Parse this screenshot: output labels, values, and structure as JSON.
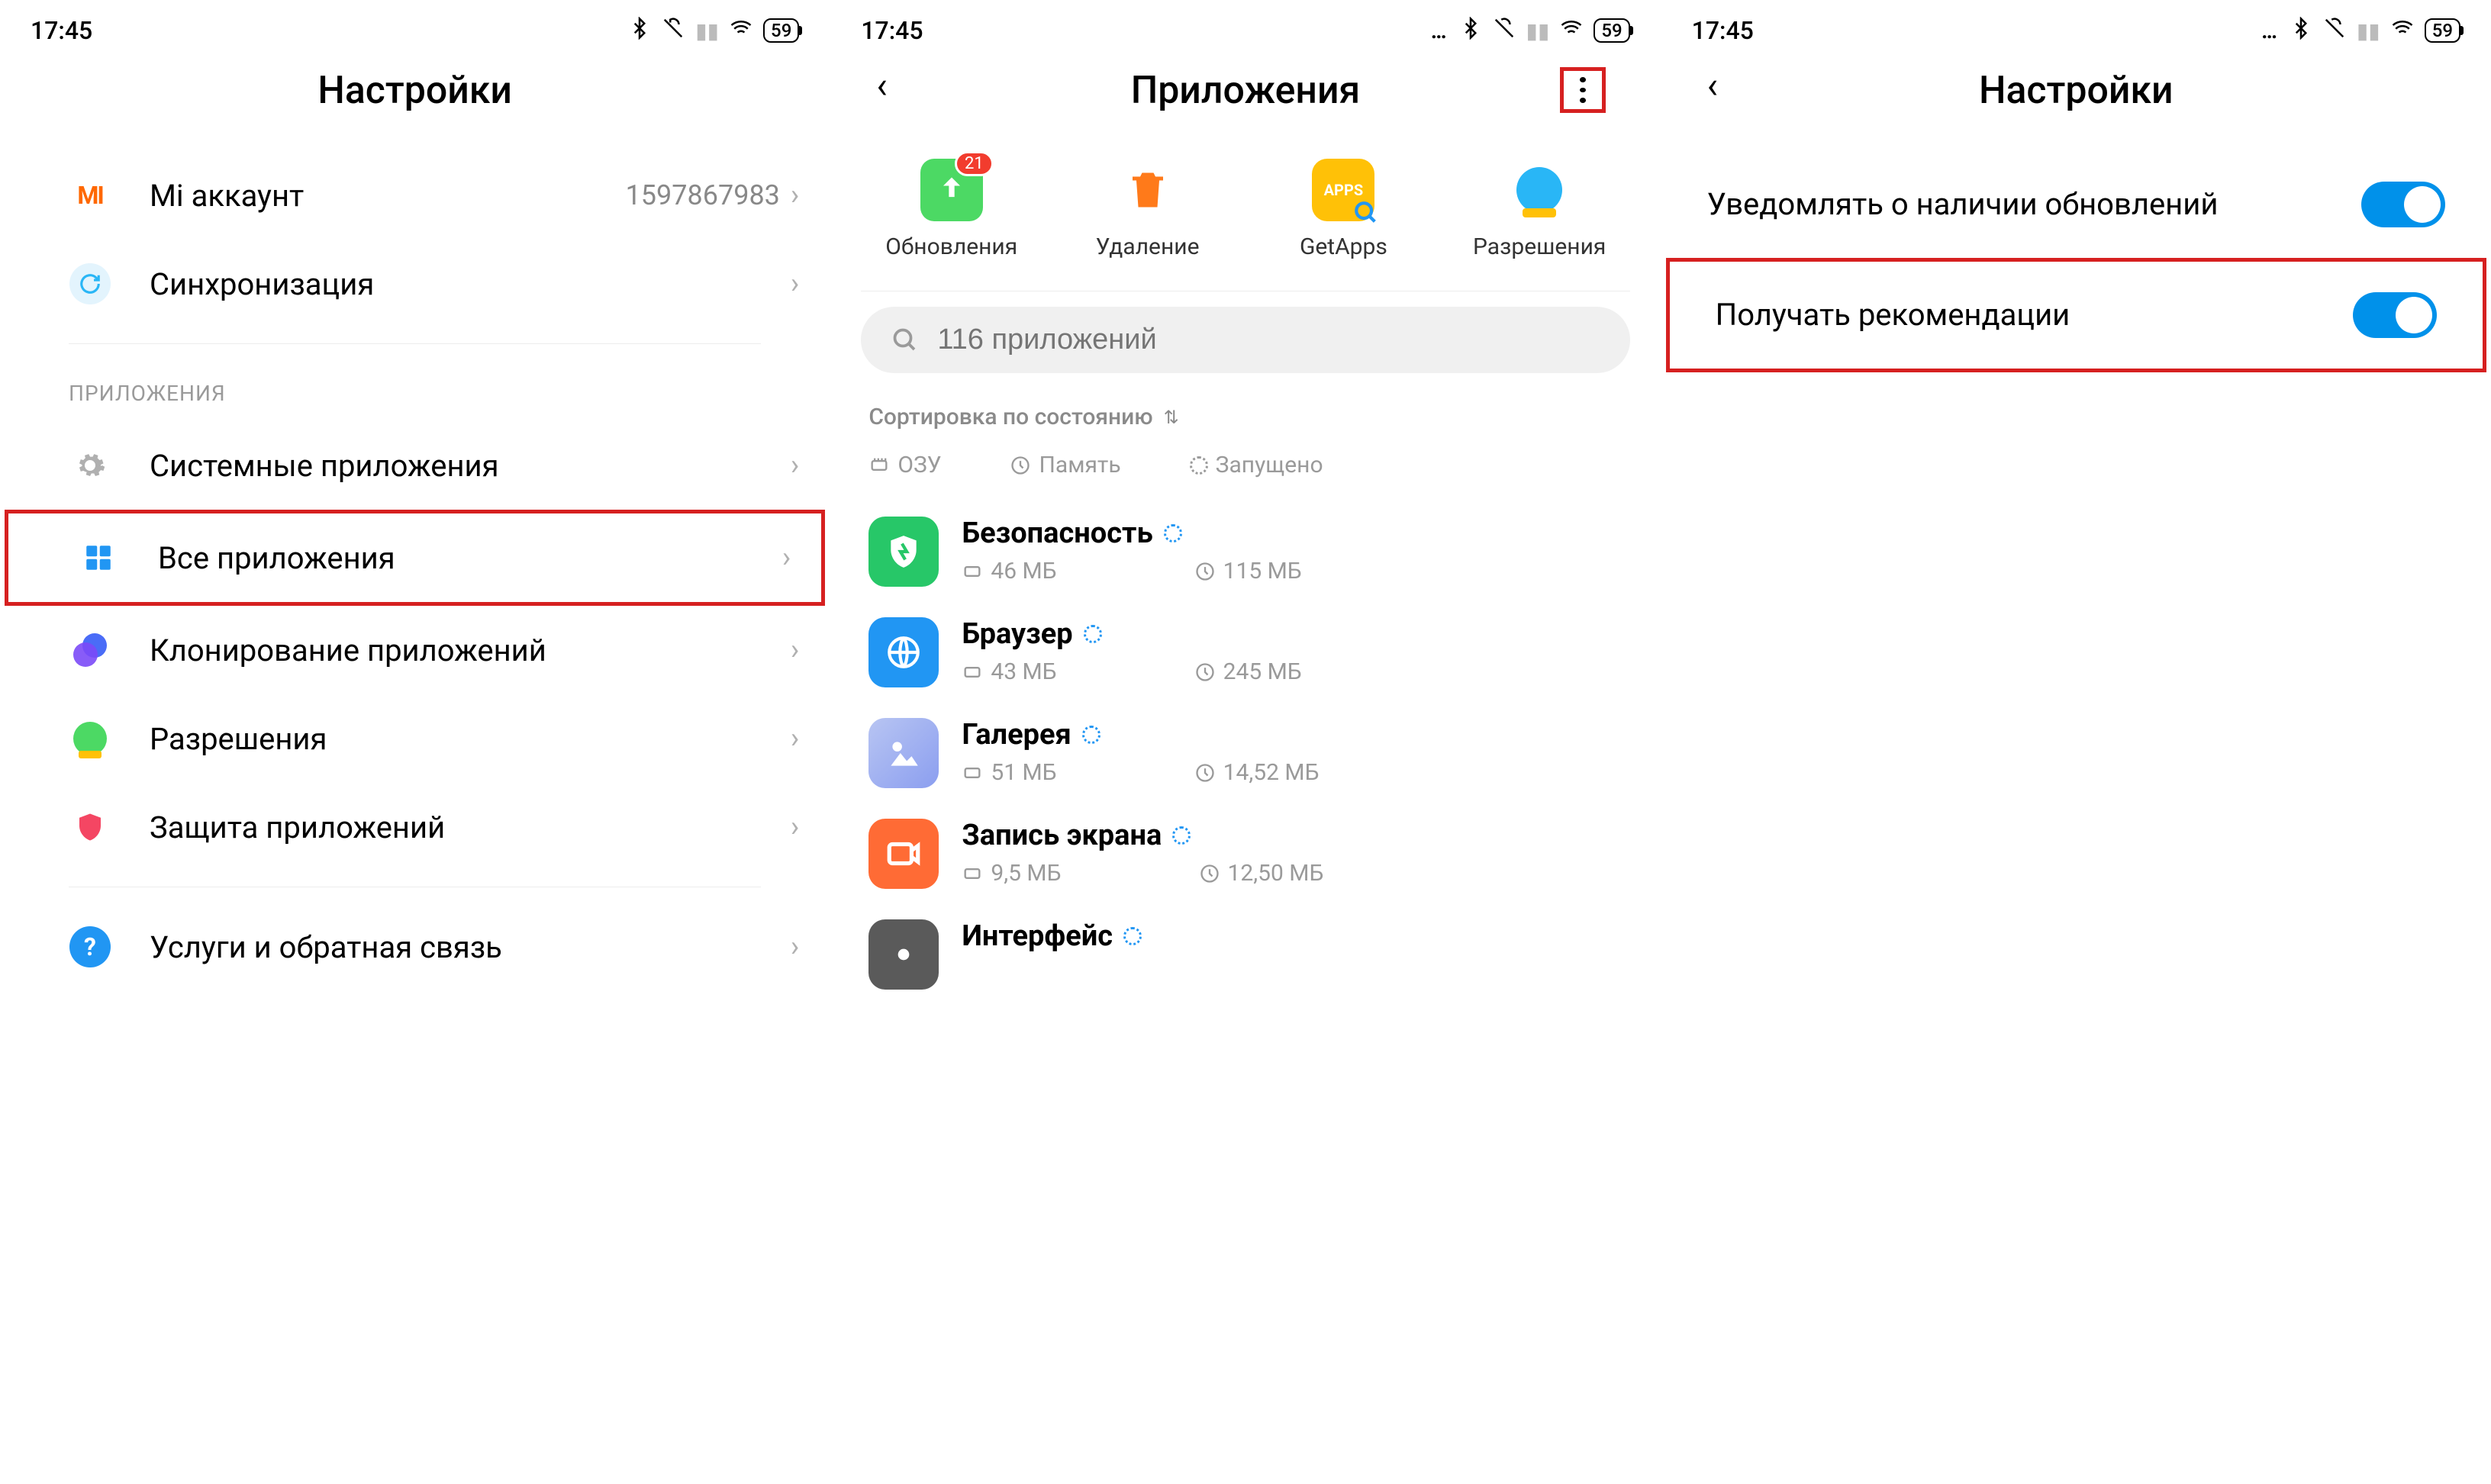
{
  "status": {
    "time": "17:45",
    "battery": "59"
  },
  "panel1": {
    "title": "Настройки",
    "mi_account_label": "Mi аккаунт",
    "mi_account_value": "1597867983",
    "sync_label": "Синхронизация",
    "section_apps": "ПРИЛОЖЕНИЯ",
    "system_apps": "Системные приложения",
    "all_apps": "Все приложения",
    "clone": "Клонирование приложений",
    "permissions": "Разрешения",
    "protection": "Защита приложений",
    "feedback": "Услуги и обратная связь"
  },
  "panel2": {
    "title": "Приложения",
    "actions": {
      "updates": "Обновления",
      "updates_badge": "21",
      "uninstall": "Удаление",
      "getapps": "GetApps",
      "perms": "Разрешения"
    },
    "search_placeholder": "116 приложений",
    "sort_label": "Сортировка по состоянию",
    "meta": {
      "ram": "ОЗУ",
      "storage": "Память",
      "running": "Запущено"
    },
    "apps": [
      {
        "name": "Безопасность",
        "ram": "46 МБ",
        "storage": "115 МБ",
        "color": "#27c768"
      },
      {
        "name": "Браузер",
        "ram": "43 МБ",
        "storage": "245 МБ",
        "color": "#2196f3"
      },
      {
        "name": "Галерея",
        "ram": "51 МБ",
        "storage": "14,52 МБ",
        "color": "#8b9ef0"
      },
      {
        "name": "Запись экрана",
        "ram": "9,5 МБ",
        "storage": "12,50 МБ",
        "color": "#ff6b35"
      },
      {
        "name": "Интерфейс",
        "ram": "",
        "storage": "",
        "color": "#5a5a5a"
      }
    ]
  },
  "panel3": {
    "title": "Настройки",
    "notify_updates": "Уведомлять о наличии обновлений",
    "recommendations": "Получать рекомендации"
  }
}
